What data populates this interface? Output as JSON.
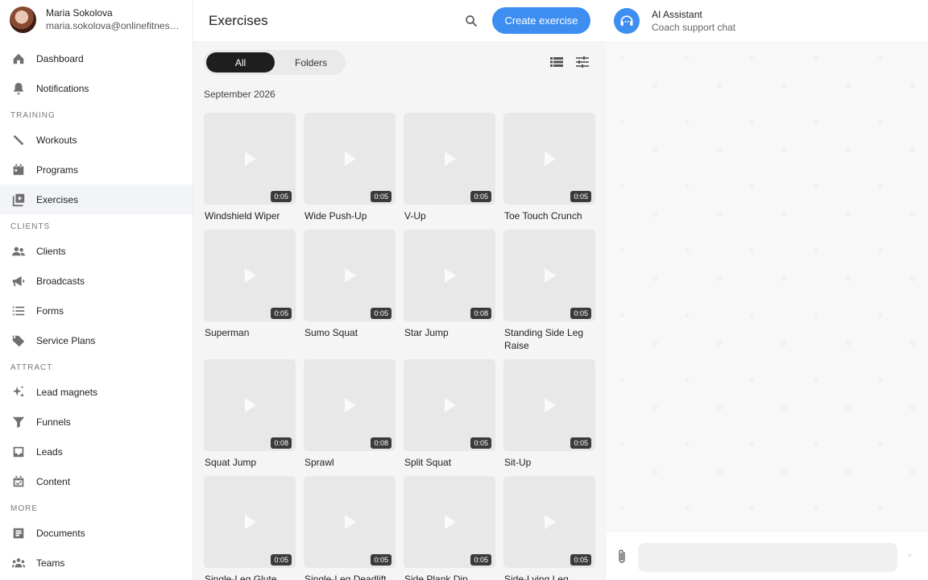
{
  "user": {
    "name": "Maria Sokolova",
    "email": "maria.sokolova@onlinefitness.com"
  },
  "sidebar": {
    "top_items": [
      {
        "label": "Dashboard",
        "icon": "home-icon"
      },
      {
        "label": "Notifications",
        "icon": "bell-icon"
      }
    ],
    "sections": [
      {
        "title": "Training",
        "items": [
          {
            "label": "Workouts",
            "icon": "dumbbell-icon"
          },
          {
            "label": "Programs",
            "icon": "calendar-icon"
          },
          {
            "label": "Exercises",
            "icon": "video-library-icon",
            "active": true
          }
        ]
      },
      {
        "title": "Clients",
        "items": [
          {
            "label": "Clients",
            "icon": "people-icon"
          },
          {
            "label": "Broadcasts",
            "icon": "megaphone-icon"
          },
          {
            "label": "Forms",
            "icon": "list-icon"
          },
          {
            "label": "Service Plans",
            "icon": "tag-icon"
          }
        ]
      },
      {
        "title": "Attract",
        "items": [
          {
            "label": "Lead magnets",
            "icon": "sparkle-icon"
          },
          {
            "label": "Funnels",
            "icon": "funnel-icon"
          },
          {
            "label": "Leads",
            "icon": "inbox-icon"
          },
          {
            "label": "Content",
            "icon": "calendar-check-icon"
          }
        ]
      },
      {
        "title": "More",
        "items": [
          {
            "label": "Documents",
            "icon": "document-icon"
          },
          {
            "label": "Teams",
            "icon": "team-icon"
          }
        ]
      }
    ]
  },
  "main": {
    "title": "Exercises",
    "create_label": "Create exercise",
    "tabs": {
      "all": "All",
      "folders": "Folders"
    },
    "month": "September 2026",
    "exercises": [
      {
        "name": "Windshield Wiper",
        "duration": "0:05"
      },
      {
        "name": "Wide Push-Up",
        "duration": "0:05"
      },
      {
        "name": "V-Up",
        "duration": "0:05"
      },
      {
        "name": "Toe Touch Crunch",
        "duration": "0:05"
      },
      {
        "name": "Superman",
        "duration": "0:05"
      },
      {
        "name": "Sumo Squat",
        "duration": "0:05"
      },
      {
        "name": "Star Jump",
        "duration": "0:08"
      },
      {
        "name": "Standing Side Leg Raise",
        "duration": "0:05"
      },
      {
        "name": "Squat Jump",
        "duration": "0:08"
      },
      {
        "name": "Sprawl",
        "duration": "0:08"
      },
      {
        "name": "Split Squat",
        "duration": "0:05"
      },
      {
        "name": "Sit-Up",
        "duration": "0:05"
      },
      {
        "name": "Single-Leg Glute",
        "duration": "0:05"
      },
      {
        "name": "Single-Leg Deadlift",
        "duration": "0:05"
      },
      {
        "name": "Side Plank Dip",
        "duration": "0:05"
      },
      {
        "name": "Side-Lying Leg Raise",
        "duration": "0:05"
      }
    ]
  },
  "chat": {
    "name": "AI Assistant",
    "subtitle": "Coach support chat",
    "input_placeholder": "",
    "send_label": ">"
  },
  "colors": {
    "accent": "#3d8ef0",
    "active_bg": "#f2f4f7"
  }
}
